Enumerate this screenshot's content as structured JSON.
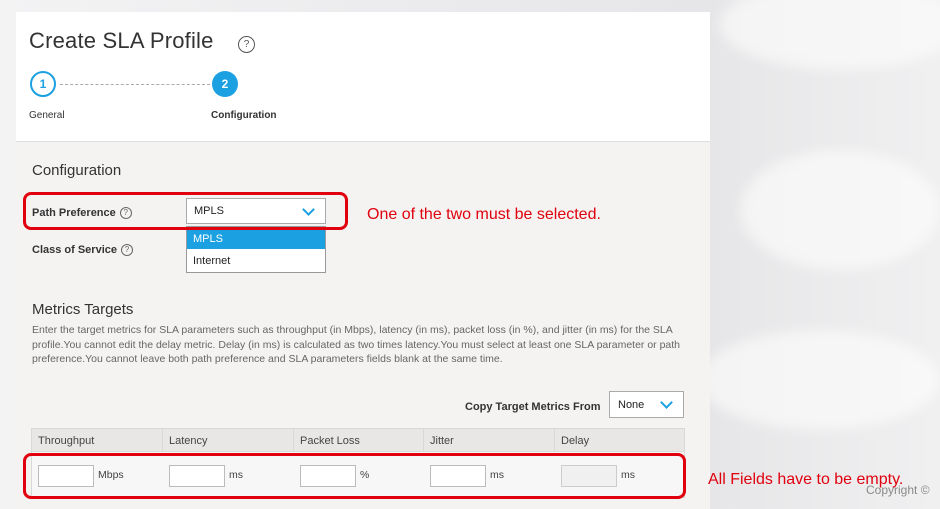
{
  "title": "Create SLA Profile",
  "title_help_icon": "question-circle-icon",
  "steps": [
    {
      "number": "1",
      "label": "General",
      "state": "completed"
    },
    {
      "number": "2",
      "label": "Configuration",
      "state": "active"
    }
  ],
  "configuration": {
    "heading": "Configuration",
    "path_preference": {
      "label": "Path Preference",
      "value": "MPLS",
      "options": [
        "MPLS",
        "Internet"
      ]
    },
    "class_of_service": {
      "label": "Class of Service"
    }
  },
  "metrics": {
    "heading": "Metrics Targets",
    "description": "Enter the target metrics for SLA parameters such as throughput (in Mbps), latency (in ms), packet loss (in %), and jitter (in ms) for the SLA profile.You cannot edit the delay metric. Delay (in ms) is calculated as two times latency.You must select at least one SLA parameter or path preference.You cannot leave both path preference and SLA parameters fields blank at the same time.",
    "copy_from_label": "Copy Target Metrics From",
    "copy_from_value": "None",
    "columns": [
      {
        "header": "Throughput",
        "unit": "Mbps",
        "value": ""
      },
      {
        "header": "Latency",
        "unit": "ms",
        "value": ""
      },
      {
        "header": "Packet Loss",
        "unit": "%",
        "value": ""
      },
      {
        "header": "Jitter",
        "unit": "ms",
        "value": ""
      },
      {
        "header": "Delay",
        "unit": "ms",
        "value": ""
      }
    ]
  },
  "annotations": {
    "path_note": "One of the two must be selected.",
    "fields_note": "All Fields have to be empty."
  },
  "footer": {
    "copyright": "Copyright ©"
  },
  "colors": {
    "accent": "#1ba1e2",
    "annotation": "#e0000e"
  }
}
